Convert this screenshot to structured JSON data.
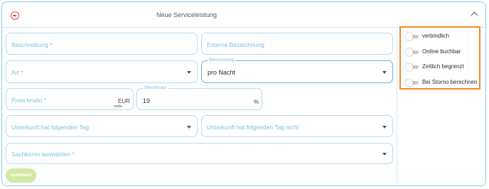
{
  "panel": {
    "title": "Neue Serviceleistung"
  },
  "form": {
    "beschreibung_label": "Beschreibung *",
    "externe_bezeichnung_label": "Externe Bezeichnung",
    "art_label": "Art *",
    "berechnung_label": "Berechnung",
    "berechnung_value": "pro Nacht",
    "preis_label": "Preis brutto *",
    "preis_unit": "EUR",
    "preis_hint": "netto",
    "steuersatz_label": "Steuersatz",
    "steuersatz_value": "19",
    "steuersatz_unit": "%",
    "unterkunft_tag_label": "Unterkunft hat folgenden Tag",
    "unterkunft_tag_nicht_label": "Unterkunft hat folgenden Tag nicht",
    "sachkonto_label": "Sachkonto auswählen *",
    "save_label": "speichern"
  },
  "toggles": [
    {
      "label": "verbindlich",
      "checked": false
    },
    {
      "label": "Online buchbar",
      "checked": false
    },
    {
      "label": "Zeitlich begrenzt",
      "checked": false
    },
    {
      "label": "Bei Storno berechnen",
      "checked": false
    }
  ],
  "colors": {
    "accent": "#7cc0e0",
    "highlight": "#f08a2c",
    "remove": "#e0484b",
    "save_button": "#d3e8a2"
  },
  "icons": [
    "minus-circle-icon",
    "chevron-up-icon",
    "dropdown-caret-icon"
  ]
}
